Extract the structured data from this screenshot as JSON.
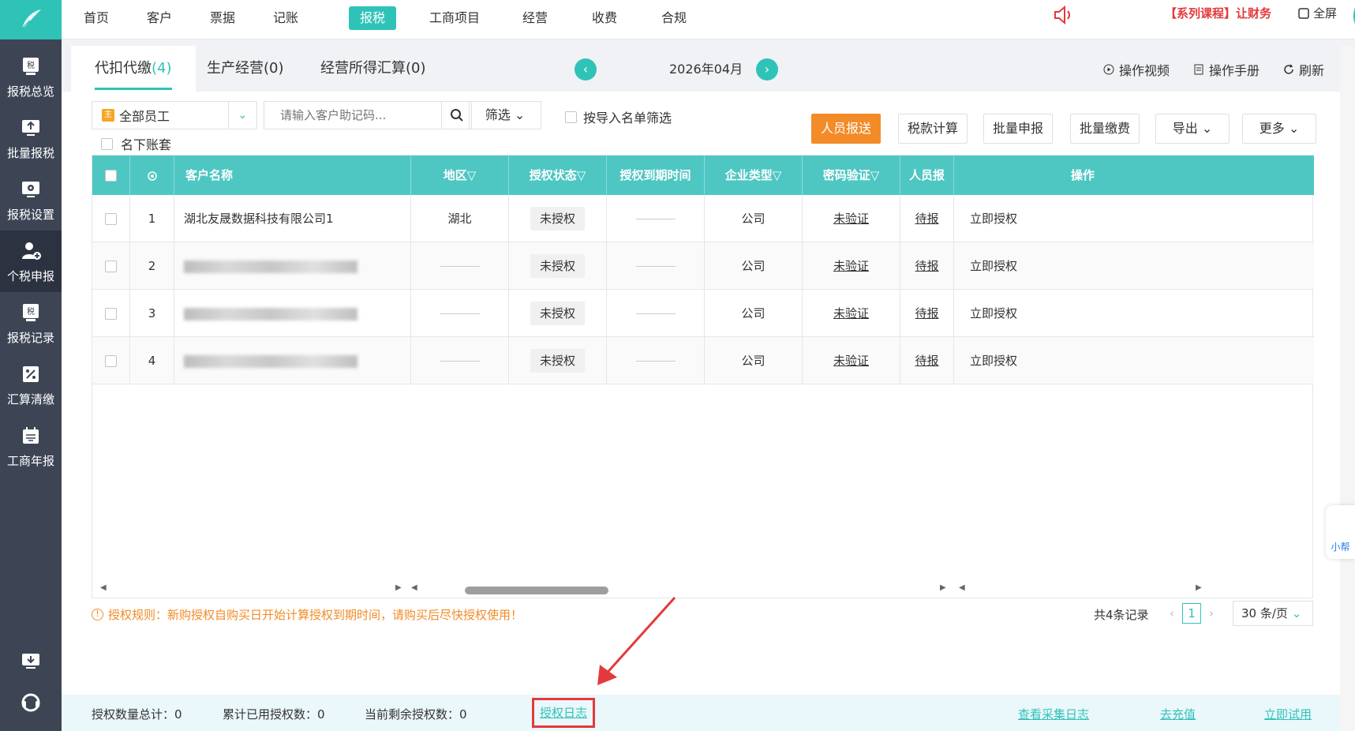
{
  "sidebar": {
    "items": [
      {
        "label": "报税总览"
      },
      {
        "label": "批量报税"
      },
      {
        "label": "报税设置"
      },
      {
        "label": "个税申报"
      },
      {
        "label": "报税记录"
      },
      {
        "label": "汇算清缴"
      },
      {
        "label": "工商年报"
      }
    ]
  },
  "topnav": {
    "items": [
      {
        "label": "首页"
      },
      {
        "label": "客户"
      },
      {
        "label": "票据"
      },
      {
        "label": "记账"
      },
      {
        "label": "报税"
      },
      {
        "label": "工商项目"
      },
      {
        "label": "经营"
      },
      {
        "label": "收费"
      },
      {
        "label": "合规"
      }
    ],
    "promo": "【系列课程】让财务",
    "fullscreen": "全屏"
  },
  "tabs": [
    {
      "label": "代扣代缴",
      "count": "(4)"
    },
    {
      "label": "生产经营(0)"
    },
    {
      "label": "经营所得汇算(0)"
    }
  ],
  "month": "2026年04月",
  "tools": {
    "video": "操作视频",
    "manual": "操作手册",
    "refresh": "刷新"
  },
  "filters": {
    "employee": "全部员工",
    "search_placeholder": "请输入客户助记码...",
    "filter": "筛选",
    "import_filter": "按导入名单筛选",
    "sub_accounts": "名下账套"
  },
  "actions": {
    "report": "人员报送",
    "calc": "税款计算",
    "batch_declare": "批量申报",
    "batch_pay": "批量缴费",
    "export": "导出",
    "more": "更多"
  },
  "table": {
    "headers": {
      "name": "客户名称",
      "region": "地区",
      "auth_status": "授权状态",
      "auth_expire": "授权到期时间",
      "company_type": "企业类型",
      "pwd_verify": "密码验证",
      "person": "人员报",
      "ops": "操作"
    },
    "rows": [
      {
        "idx": "1",
        "name": "湖北友晟数据科技有限公司1",
        "region": "湖北",
        "status": "未授权",
        "type": "公司",
        "verify": "未验证",
        "person": "待报",
        "op": "立即授权"
      },
      {
        "idx": "2",
        "name": "",
        "region": "",
        "status": "未授权",
        "type": "公司",
        "verify": "未验证",
        "person": "待报",
        "op": "立即授权"
      },
      {
        "idx": "3",
        "name": "",
        "region": "",
        "status": "未授权",
        "type": "公司",
        "verify": "未验证",
        "person": "待报",
        "op": "立即授权"
      },
      {
        "idx": "4",
        "name": "",
        "region": "",
        "status": "未授权",
        "type": "公司",
        "verify": "未验证",
        "person": "待报",
        "op": "立即授权"
      }
    ]
  },
  "footer": {
    "rule": "授权规则：新购授权自购买日开始计算授权到期时间，请购买后尽快授权使用！",
    "total": "共4条记录",
    "page": "1",
    "page_size": "30 条/页"
  },
  "stats": {
    "total_auth": "授权数量总计：0",
    "used_auth": "累计已用授权数：0",
    "remaining_auth": "当前剩余授权数：0",
    "auth_log": "授权日志",
    "collect_log": "查看采集日志",
    "recharge": "去充值",
    "trial": "立即试用"
  },
  "side_tab": "小帮",
  "colors": {
    "accent": "#2fc3b8",
    "primary_button": "#f28b28",
    "highlight_box": "#e4393c"
  }
}
